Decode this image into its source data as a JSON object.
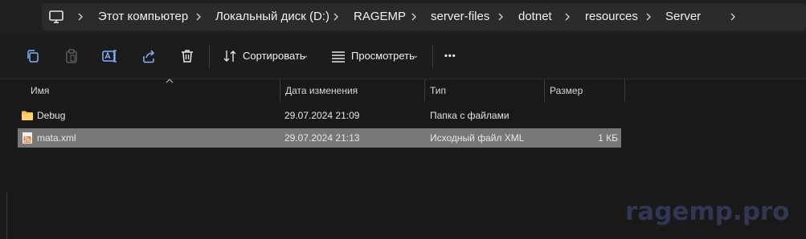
{
  "breadcrumb": {
    "items": [
      "Этот компьютер",
      "Локальный диск (D:)",
      "RAGEMP",
      "server-files",
      "dotnet",
      "resources",
      "Server"
    ]
  },
  "toolbar": {
    "sort_label": "Сортировать",
    "view_label": "Просмотреть",
    "more_label": "•••"
  },
  "columns": {
    "name": "Имя",
    "date": "Дата изменения",
    "type": "Тип",
    "size": "Размер"
  },
  "files": [
    {
      "name": "Debug",
      "date": "29.07.2024 21:09",
      "type": "Папка с файлами",
      "size": "",
      "icon": "folder-icon"
    },
    {
      "name": "mata.xml",
      "date": "29.07.2024 21:13",
      "type": "Исходный файл XML",
      "size": "1 КБ",
      "icon": "rss-file-icon",
      "selected": true
    }
  ],
  "watermark": "ragemp.pro",
  "colors": {
    "background": "#191919",
    "selected_row": "#777777",
    "folder": "#f2c14e",
    "rss": "#e8772e",
    "watermark": "#313653"
  }
}
